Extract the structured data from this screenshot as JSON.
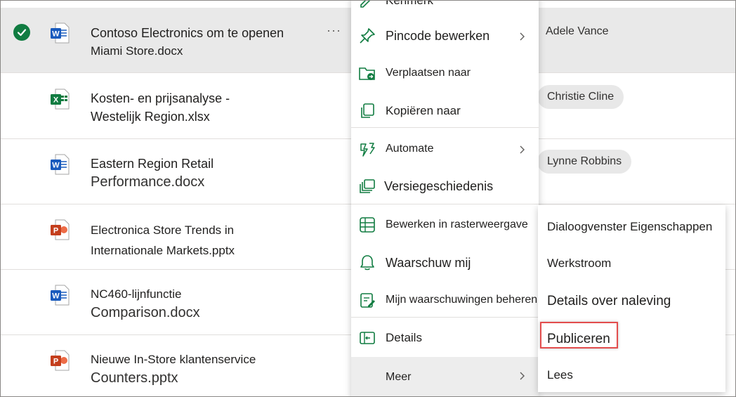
{
  "files": [
    {
      "line1": "Contoso Electronics om te openen",
      "line2": "Miami Store.docx",
      "type": "word",
      "selected": true,
      "person": "Adele Vance"
    },
    {
      "line1": "Kosten- en prijsanalyse -",
      "line2": "Westelijk Region.xlsx",
      "type": "excel",
      "person": "Christie Cline"
    },
    {
      "line1": "Eastern Region Retail",
      "line2": "Performance.docx",
      "type": "word",
      "person": "Lynne Robbins"
    },
    {
      "line1": "Electronica Store Trends in",
      "line2": "Internationale Markets.pptx",
      "type": "powerpoint"
    },
    {
      "line1": "NC460-lijnfunctie",
      "line2": "Comparison.docx",
      "type": "word"
    },
    {
      "line1": "Nieuwe In-Store klantenservice",
      "line2": "Counters.pptx",
      "type": "powerpoint"
    }
  ],
  "row_more": "···",
  "menu": {
    "partial_top": "Kenmerk",
    "items": [
      {
        "label": "Pincode bewerken",
        "icon": "pin-icon",
        "submenu": true
      },
      {
        "label": "Verplaatsen naar",
        "icon": "move-folder-icon"
      },
      {
        "label": "Kopiëren naar",
        "icon": "copy-icon"
      },
      {
        "label": "Automate",
        "icon": "automate-icon",
        "submenu": true
      },
      {
        "label": "Versiegeschiedenis",
        "icon": "version-history-icon"
      },
      {
        "label": "Bewerken in rasterweergave",
        "icon": "grid-icon"
      },
      {
        "label": "Waarschuw mij",
        "icon": "bell-icon"
      },
      {
        "label": "Mijn waarschuwingen beheren",
        "icon": "manage-alerts-icon"
      },
      {
        "label": "Details",
        "icon": "details-icon"
      },
      {
        "label": "Meer",
        "icon": "",
        "submenu": true
      }
    ]
  },
  "submenu": {
    "items": [
      {
        "label": "Dialoogvenster Eigenschappen"
      },
      {
        "label": "Werkstroom"
      },
      {
        "label": "Details over naleving"
      },
      {
        "label": "Publiceren"
      },
      {
        "label": "Lees"
      }
    ]
  },
  "colors": {
    "accent_highlight": "#e34d4d",
    "check": "#107c41",
    "word": "#185abd",
    "excel": "#107c41",
    "powerpoint": "#c43e1c"
  }
}
